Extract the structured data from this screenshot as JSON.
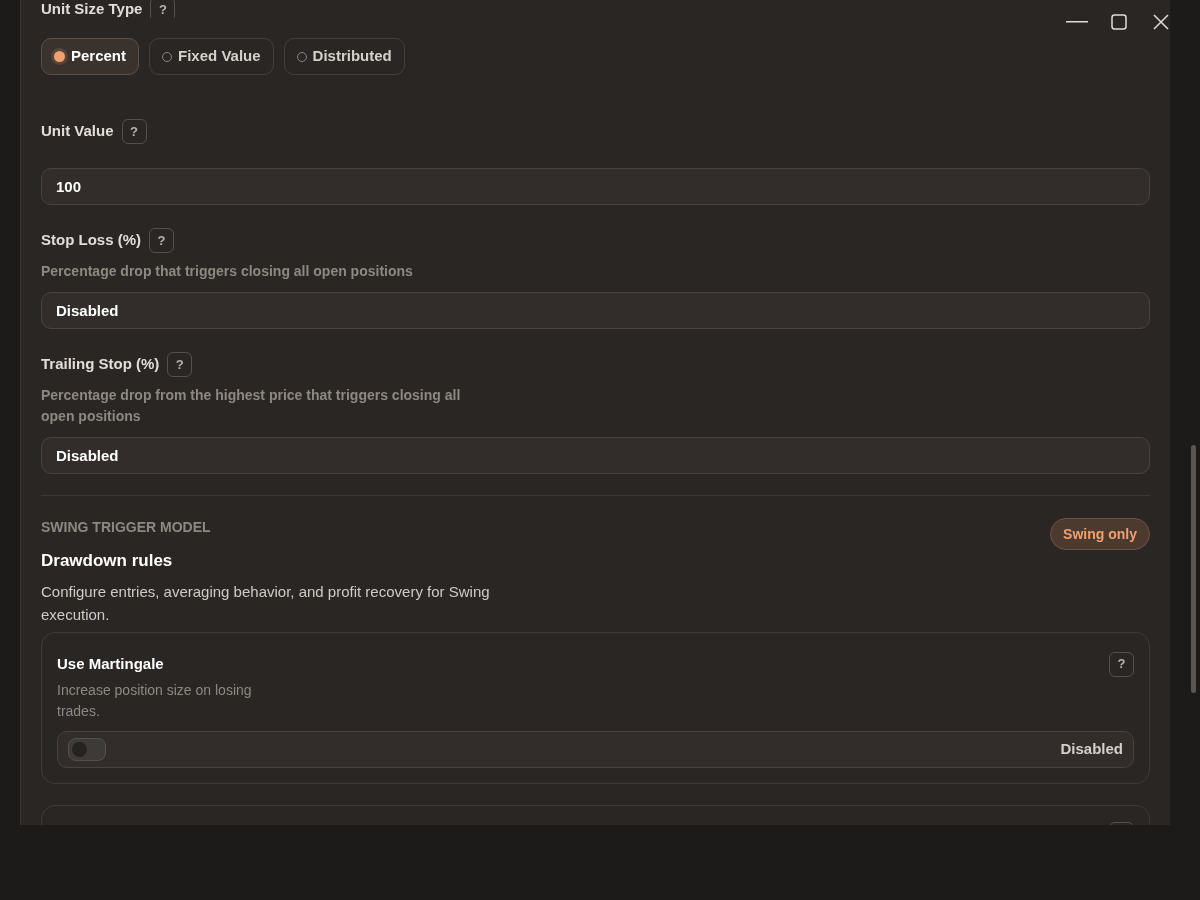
{
  "fields": [
    {
      "kind": "radio_group",
      "label": "Unit Size Type",
      "help": "?",
      "options": [
        {
          "label": "Percent",
          "selected": true
        },
        {
          "label": "Fixed Value",
          "selected": false
        },
        {
          "label": "Distributed",
          "selected": false
        }
      ]
    },
    {
      "kind": "input",
      "label": "Unit Value",
      "help": "?",
      "value": "100"
    },
    {
      "kind": "input",
      "label": "Stop Loss (%)",
      "help": "?",
      "hint": "Percentage drop that triggers closing all open positions",
      "value": "Disabled"
    },
    {
      "kind": "input",
      "label": "Trailing Stop (%)",
      "help": "?",
      "hint": "Percentage drop from the highest price that triggers closing all open positions",
      "value": "Disabled"
    }
  ],
  "section": {
    "eyebrow": "SWING TRIGGER MODEL",
    "title": "Drawdown rules",
    "description": "Configure entries, averaging behavior, and profit recovery for Swing execution.",
    "badge": "Swing only",
    "settings": [
      {
        "kind": "toggle",
        "title": "Use Martingale",
        "help": "?",
        "description": "Increase position size on losing trades.",
        "on": false,
        "state_label": "Disabled"
      },
      {
        "kind": "cut_card"
      }
    ]
  }
}
